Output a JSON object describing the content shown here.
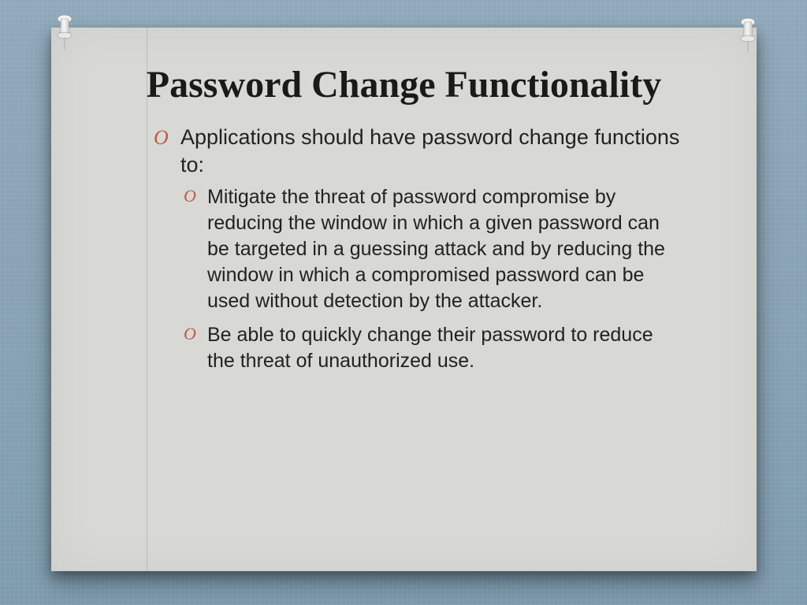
{
  "slide": {
    "title": "Password Change Functionality",
    "bullet_symbol": "O",
    "bullets": {
      "lead": "Applications should have password change functions to:",
      "sub": [
        "Mitigate the threat of password compromise by reducing the window in which a given password can be targeted in a guessing attack and by reducing the window in which a compromised password can be used without detection by the attacker.",
        "Be able to quickly change their password to reduce the threat of unauthorized use."
      ]
    }
  },
  "colors": {
    "bullet_marker": "#c05a46"
  }
}
